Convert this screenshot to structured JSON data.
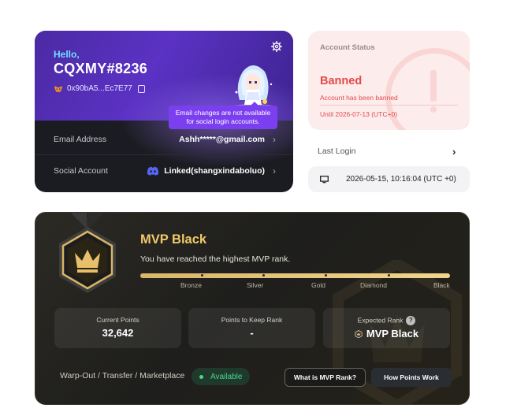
{
  "profile": {
    "greeting": "Hello,",
    "username": "CQXMY#8236",
    "wallet": "0x90bA5...Ec7E77",
    "tooltip_line1": "Email changes are not available",
    "tooltip_line2": "for social login accounts.",
    "email_label": "Email Address",
    "email_value": "Ashh*****@gmail.com",
    "social_label": "Social Account",
    "social_status": "Linked",
    "social_name": "(shangxindaboluo)"
  },
  "account_status": {
    "title": "Account Status",
    "status": "Banned",
    "message": "Account has been banned",
    "until": "Until 2026-07-13 (UTC+0)"
  },
  "last_login": {
    "title": "Last Login",
    "time": "2026-05-15, 10:16:04 (UTC +0)"
  },
  "mvp": {
    "title": "MVP Black",
    "subtitle": "You have reached the highest MVP rank.",
    "ranks": [
      "Bronze",
      "Silver",
      "Gold",
      "Diamond",
      "Black"
    ],
    "progress": 1.0,
    "current_points_label": "Current Points",
    "current_points": "32,642",
    "keep_label": "Points to Keep Rank",
    "keep_value": "-",
    "expected_label": "Expected Rank",
    "expected_help": "?",
    "expected_value": "MVP Black",
    "warp_label": "Warp-Out / Transfer / Marketplace",
    "availability": "Available",
    "what_button": "What is MVP Rank?",
    "how_button": "How Points Work"
  },
  "colors": {
    "profile_gradient": "#5b32c4",
    "banned": "#e24a4a",
    "mvp_gold": "#f0c96b",
    "available_green": "#4ad68c"
  },
  "icons": [
    "settings-gear-icon",
    "metamask-fox-icon",
    "copy-icon",
    "chevron-right-icon",
    "discord-icon",
    "monitor-icon",
    "crown-icon",
    "help-icon",
    "warning-icon"
  ]
}
